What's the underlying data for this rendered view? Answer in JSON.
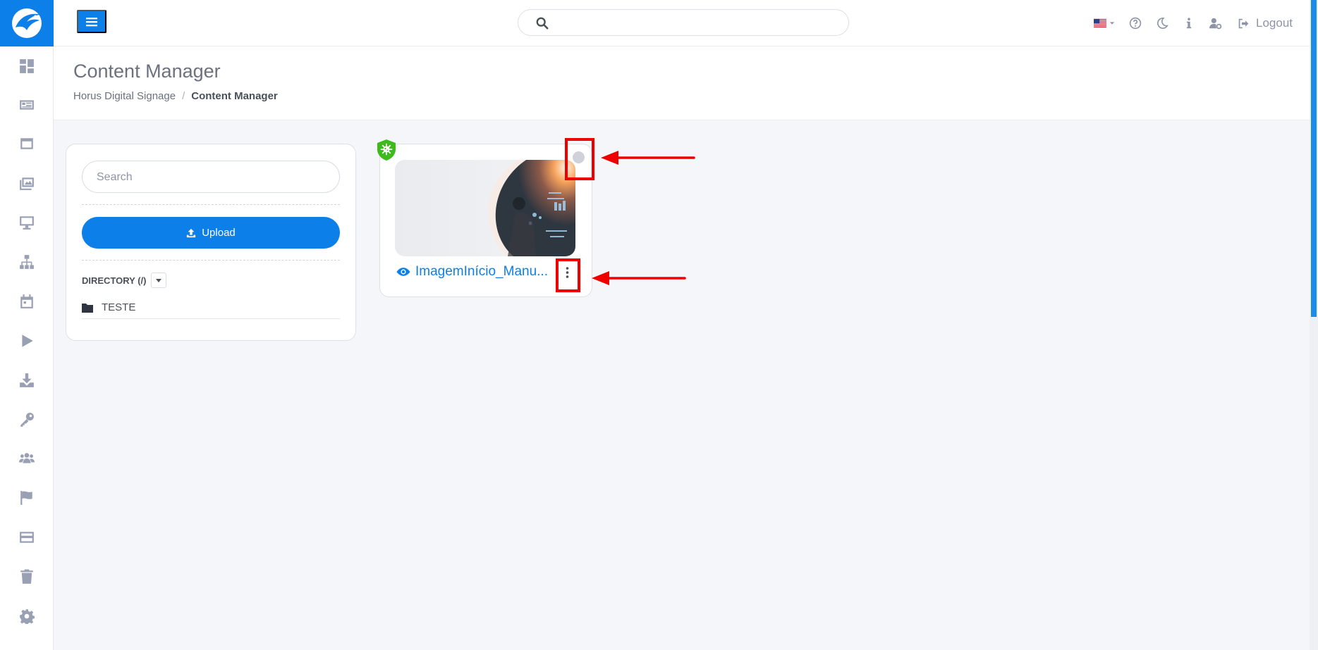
{
  "app": {
    "logo_icon": "eagle-logo-icon",
    "accent": "#0d7fe8"
  },
  "sidebar": {
    "items": [
      {
        "icon": "dashboard-icon"
      },
      {
        "icon": "news-icon"
      },
      {
        "icon": "window-icon"
      },
      {
        "icon": "images-icon"
      },
      {
        "icon": "monitor-icon"
      },
      {
        "icon": "sitemap-icon"
      },
      {
        "icon": "calendar-icon"
      },
      {
        "icon": "play-icon"
      },
      {
        "icon": "download-icon"
      },
      {
        "icon": "key-icon"
      },
      {
        "icon": "users-icon"
      },
      {
        "icon": "flag-icon"
      },
      {
        "icon": "card-icon"
      },
      {
        "icon": "trash-icon"
      },
      {
        "icon": "gear-icon"
      }
    ]
  },
  "topbar": {
    "search_value": "",
    "language": "en-US",
    "logout_label": "Logout"
  },
  "page": {
    "title": "Content Manager",
    "breadcrumb": [
      "Horus Digital Signage",
      "Content Manager"
    ],
    "breadcrumb_separator": "/"
  },
  "left_panel": {
    "search_placeholder": "Search",
    "upload_label": "Upload",
    "directory_label": "DIRECTORY (/)",
    "folders": [
      "TESTE"
    ]
  },
  "content_items": [
    {
      "name": "ImagemInício_Manu...",
      "protected": true,
      "selected": false
    }
  ],
  "annotations": {
    "color": "#ee0000"
  }
}
